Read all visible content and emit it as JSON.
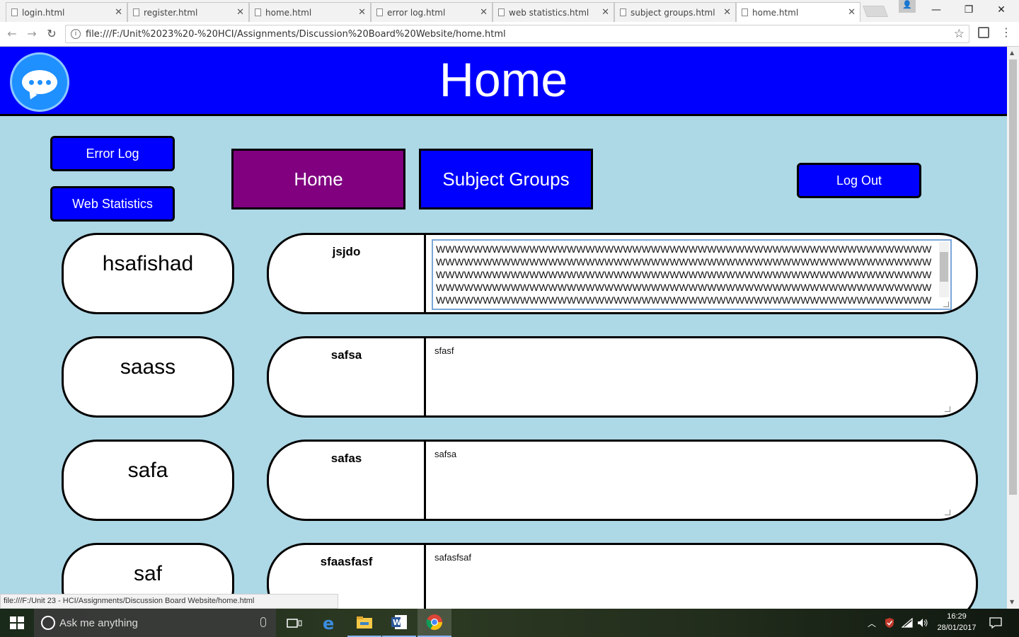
{
  "browser": {
    "tabs": [
      {
        "title": "login.html",
        "active": false
      },
      {
        "title": "register.html",
        "active": false
      },
      {
        "title": "home.html",
        "active": false
      },
      {
        "title": "error log.html",
        "active": false
      },
      {
        "title": "web statistics.html",
        "active": false
      },
      {
        "title": "subject groups.html",
        "active": false
      },
      {
        "title": "home.html",
        "active": true
      }
    ],
    "url": "file:///F:/Unit%2023%20-%20HCI/Assignments/Discussion%20Board%20Website/home.html",
    "status_url": "file:///F:/Unit 23 - HCI/Assignments/Discussion Board Website/home.html"
  },
  "page": {
    "title": "Home",
    "buttons": {
      "error_log": "Error Log",
      "web_statistics": "Web Statistics",
      "home": "Home",
      "subject_groups": "Subject Groups",
      "log_out": "Log Out"
    },
    "posts": [
      {
        "user": "hsafishad",
        "title": "jsjdo",
        "content": "WWWWWWWWWWWWWWWWWWWWWWWWWWWWWWWWWWWWWWWWWWWWWWWWWWWWWWWWWWWWWWWWWWWWWWWWWWWWWWWWWWWWWWWWWWWWWWWWWWWWWWWWWWWWWWWWWWWWWWWWWWWWWWWWWWWWWWWWWWWWWWWWWWWWWWWWWWWWWWWWWWWWWWWWWWWWWWWWWWWWWWWWWWWWWWWWWWWWWWWWWWWWWWWWWWWWWWWWWWWWWWWWWWWWWWWWWWWWWWWWWWWWWWWWWWWWWWWWWWWWWWWWWWWWWWWWWWWWWWWWWWWWWWWWWWWWWWWWWWWWWWWWWWWWWWWWWWWWWWWWWWWWWWWWWWWWWWWWWWW"
      },
      {
        "user": "saass",
        "title": "safsa",
        "content": "sfasf"
      },
      {
        "user": "safa",
        "title": "safas",
        "content": "safsa"
      },
      {
        "user": "saf",
        "title": "sfaasfasf",
        "content": "safasfsaf"
      }
    ]
  },
  "taskbar": {
    "search_placeholder": "Ask me anything",
    "time": "16:29",
    "date": "28/01/2017"
  }
}
